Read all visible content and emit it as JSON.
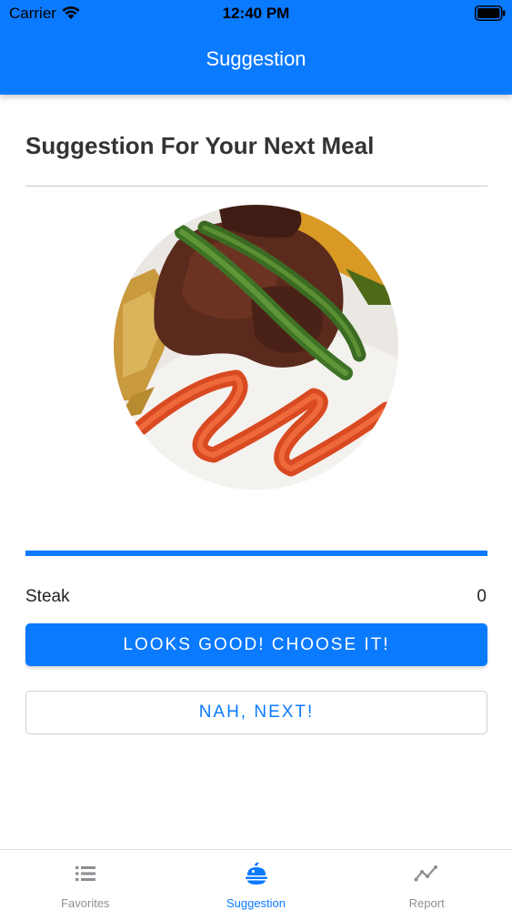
{
  "status_bar": {
    "carrier": "Carrier",
    "time": "12:40 PM",
    "wifi_icon": "wifi-icon",
    "battery_icon": "battery-full-icon"
  },
  "nav": {
    "title": "Suggestion"
  },
  "content": {
    "heading": "Suggestion For Your Next Meal",
    "photo_icon": "meal-photo-steak",
    "progress": 1.0,
    "meal_name": "Steak",
    "meal_count": "0",
    "primary_button": "LOOKS GOOD! CHOOSE IT!",
    "secondary_button": "NAH, NEXT!"
  },
  "tab_bar": {
    "tabs": [
      {
        "label": "Favorites",
        "icon": "list-icon",
        "active": false
      },
      {
        "label": "Suggestion",
        "icon": "food-icon",
        "active": true
      },
      {
        "label": "Report",
        "icon": "chart-line-icon",
        "active": false
      }
    ]
  },
  "colors": {
    "accent": "#0a7aff",
    "inactive": "#8e8e93",
    "title_text": "#333333"
  }
}
